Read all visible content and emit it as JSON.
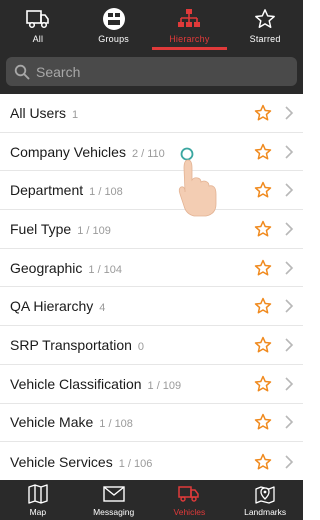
{
  "top_tabs": [
    {
      "label": "All",
      "icon": "vehicle-icon",
      "active": false
    },
    {
      "label": "Groups",
      "icon": "groups-icon",
      "active": false
    },
    {
      "label": "Hierarchy",
      "icon": "hierarchy-icon",
      "active": true
    },
    {
      "label": "Starred",
      "icon": "star-outline-icon",
      "active": false
    }
  ],
  "search": {
    "placeholder": "Search"
  },
  "list": [
    {
      "name": "All Users",
      "count": "1"
    },
    {
      "name": "Company Vehicles",
      "count": "2 / 110"
    },
    {
      "name": "Department",
      "count": "1 / 108"
    },
    {
      "name": "Fuel Type",
      "count": "1 / 109"
    },
    {
      "name": "Geographic",
      "count": "1 / 104"
    },
    {
      "name": "QA Hierarchy",
      "count": "4"
    },
    {
      "name": "SRP Transportation",
      "count": "0"
    },
    {
      "name": "Vehicle Classification",
      "count": "1 / 109"
    },
    {
      "name": "Vehicle Make",
      "count": "1 / 108"
    },
    {
      "name": "Vehicle Services",
      "count": "1 / 106"
    }
  ],
  "bottom_tabs": [
    {
      "label": "Map",
      "icon": "map-icon",
      "active": false
    },
    {
      "label": "Messaging",
      "icon": "envelope-icon",
      "active": false
    },
    {
      "label": "Vehicles",
      "icon": "truck-icon",
      "active": true
    },
    {
      "label": "Landmarks",
      "icon": "landmark-pin-icon",
      "active": false
    }
  ],
  "colors": {
    "accent": "#e03a3a",
    "star": "#f08a1e",
    "bar_bg": "#2a2a2a"
  }
}
